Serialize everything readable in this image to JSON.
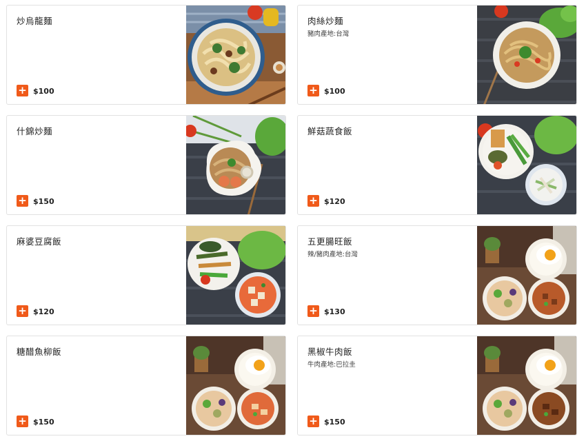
{
  "menu": {
    "items": [
      {
        "name": "炒烏龍麵",
        "desc": "",
        "price": "$100",
        "add_icon": "plus-icon"
      },
      {
        "name": "肉絲炒麵",
        "desc": "豬肉產地:台灣",
        "price": "$100",
        "add_icon": "plus-icon"
      },
      {
        "name": "什錦炒麵",
        "desc": "",
        "price": "$150",
        "add_icon": "plus-icon"
      },
      {
        "name": "鮮菇蔬食飯",
        "desc": "",
        "price": "$120",
        "add_icon": "plus-icon"
      },
      {
        "name": "麻婆豆腐飯",
        "desc": "",
        "price": "$120",
        "add_icon": "plus-icon"
      },
      {
        "name": "五更腸旺飯",
        "desc": "辣/豬肉產地:台灣",
        "price": "$130",
        "add_icon": "plus-icon"
      },
      {
        "name": "糖醋魚柳飯",
        "desc": "",
        "price": "$150",
        "add_icon": "plus-icon"
      },
      {
        "name": "黑椒牛肉飯",
        "desc": "牛肉產地:巴拉圭",
        "price": "$150",
        "add_icon": "plus-icon"
      }
    ]
  },
  "colors": {
    "accent": "#f05a1a",
    "card_border": "#e1e1e1"
  }
}
